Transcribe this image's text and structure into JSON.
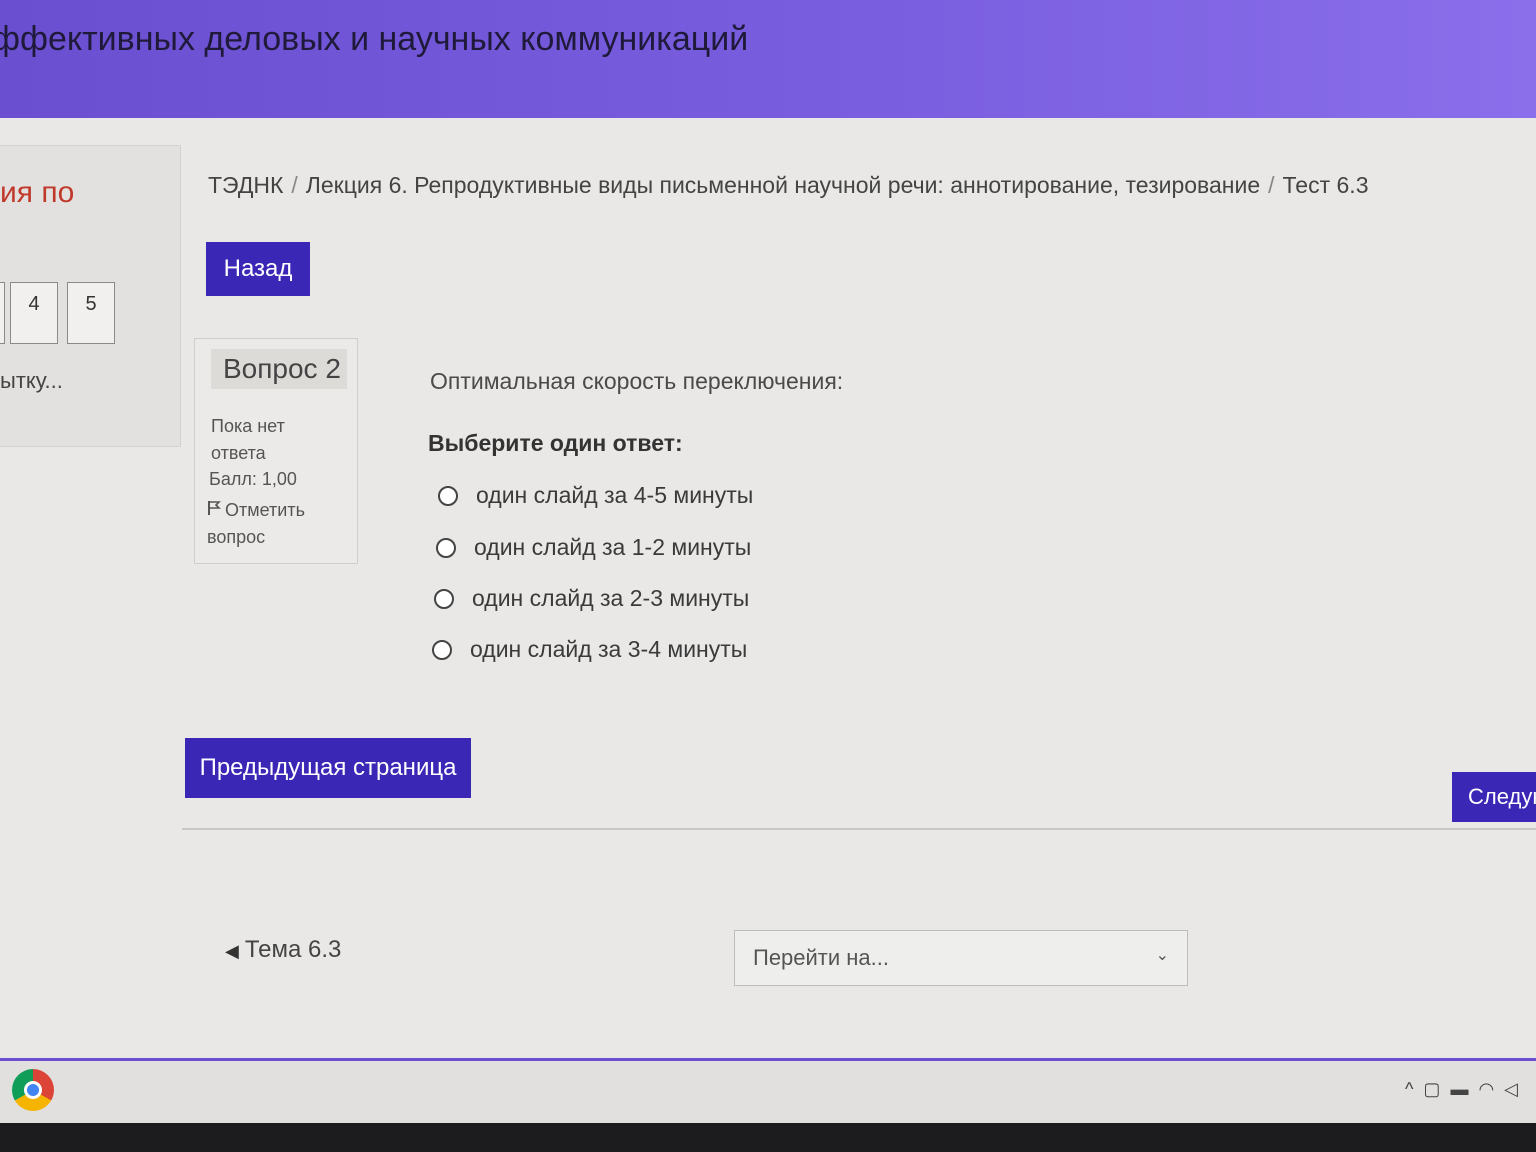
{
  "header": {
    "title": "ффективных деловых и научных коммуникаций"
  },
  "left_panel": {
    "heading": "ия по",
    "nav_numbers": [
      "4",
      "5"
    ],
    "finish_link": "ытку..."
  },
  "breadcrumb": {
    "items": [
      "ТЭДНК",
      "Лекция 6. Репродуктивные виды письменной научной речи: аннотирование, тезирование",
      "Тест 6.3"
    ],
    "separator": "/"
  },
  "back_button": "Назад",
  "question_info": {
    "title": "Вопрос 2",
    "state": "Пока нет ответа",
    "grade": "Балл: 1,00",
    "flag_label": "Отметить вопрос"
  },
  "question": {
    "text": "Оптимальная скорость переключения:",
    "prompt": "Выберите один ответ:",
    "options": [
      "один слайд за 4-5 минуты",
      "один слайд за 1-2 минуты",
      "один слайд за 2-3 минуты",
      "один слайд за 3-4 минуты"
    ]
  },
  "navigation": {
    "prev_page": "Предыдущая страница",
    "next_page": "Следую"
  },
  "activity_nav": {
    "prev_activity": "Тема 6.3",
    "jump_placeholder": "Перейти на..."
  },
  "taskbar": {
    "app": "chrome-icon"
  },
  "colors": {
    "header": "#6a4fd0",
    "button": "#3b27b5",
    "left_heading": "#c0392b"
  }
}
